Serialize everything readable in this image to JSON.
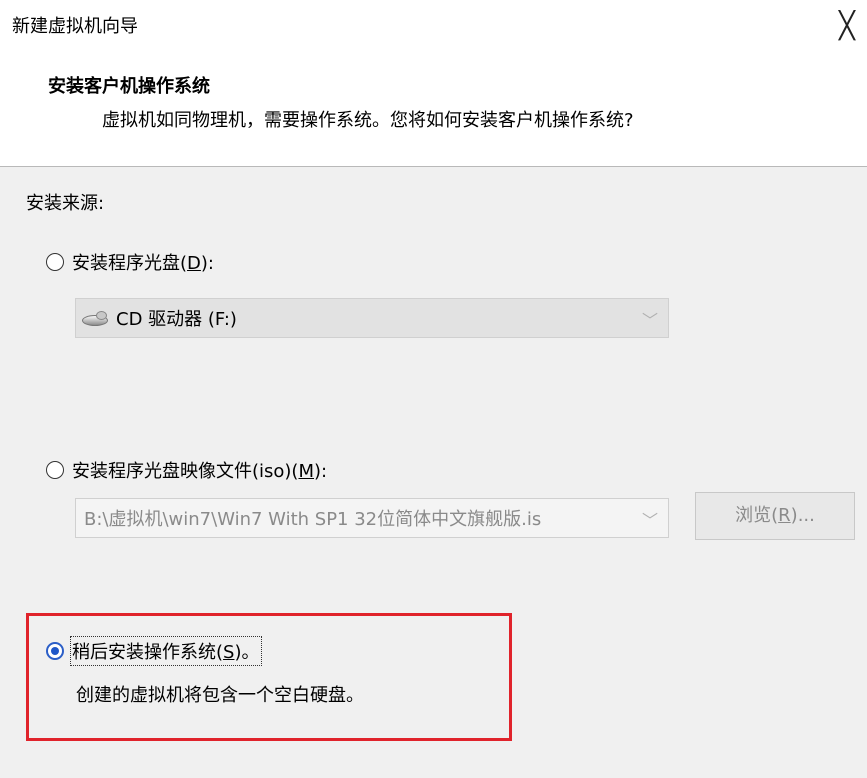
{
  "window": {
    "title": "新建虚拟机向导",
    "close_glyph": "╳"
  },
  "header": {
    "title": "安装客户机操作系统",
    "subtitle": "虚拟机如同物理机，需要操作系统。您将如何安装客户机操作系统?"
  },
  "install_source": {
    "label": "安装来源:",
    "options": [
      {
        "label_prefix": "安装程序光盘(",
        "accel": "D",
        "label_suffix": "):",
        "selected": false,
        "dropdown_value": "CD 驱动器 (F:)"
      },
      {
        "label_prefix": "安装程序光盘映像文件(iso)(",
        "accel": "M",
        "label_suffix": "):",
        "selected": false,
        "input_value": "B:\\虚拟机\\win7\\Win7 With SP1 32位简体中文旗舰版.is",
        "browse_prefix": "浏览(",
        "browse_accel": "R",
        "browse_suffix": ")..."
      },
      {
        "label_prefix": "稍后安装操作系统(",
        "accel": "S",
        "label_suffix": ")。",
        "selected": true,
        "description": "创建的虚拟机将包含一个空白硬盘。"
      }
    ]
  },
  "colors": {
    "highlight_border": "#e0232b",
    "radio_selected": "#1f57c8"
  }
}
